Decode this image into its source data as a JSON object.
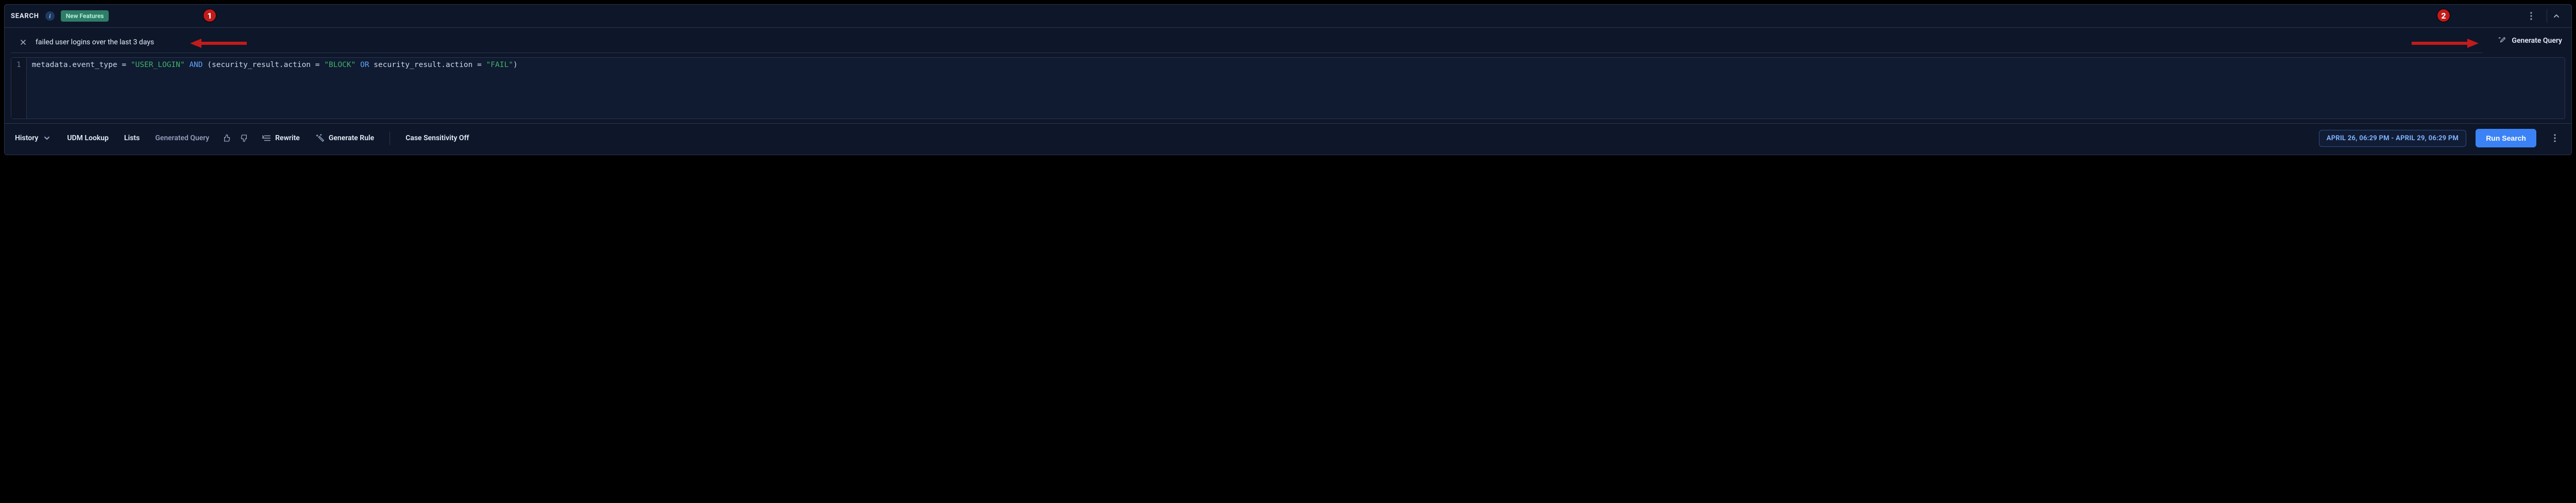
{
  "header": {
    "title": "SEARCH",
    "badge": "New Features"
  },
  "nl": {
    "query_text": "failed user logins over the last 3 days",
    "generate_btn": "Generate Query"
  },
  "editor": {
    "line_number": "1",
    "tokens": {
      "f1": "metadata.event_type",
      "eq": " = ",
      "s1": "\"USER_LOGIN\"",
      "sp1": " ",
      "and": "AND",
      "sp2": " ",
      "lp": "(",
      "f2": "security_result.action",
      "s2": "\"BLOCK\"",
      "sp3": " ",
      "or": "OR",
      "sp4": " ",
      "f3": "security_result.action",
      "s3": "\"FAIL\"",
      "rp": ")"
    }
  },
  "footer": {
    "history": "History",
    "udm": "UDM Lookup",
    "lists": "Lists",
    "gen": "Generated Query",
    "rewrite": "Rewrite",
    "gen_rule": "Generate Rule",
    "case": "Case Sensitivity Off",
    "range": "APRIL 26, 06:29 PM - APRIL 29, 06:29 PM",
    "run": "Run Search"
  },
  "annotations": {
    "c1": "1",
    "c2": "2"
  }
}
